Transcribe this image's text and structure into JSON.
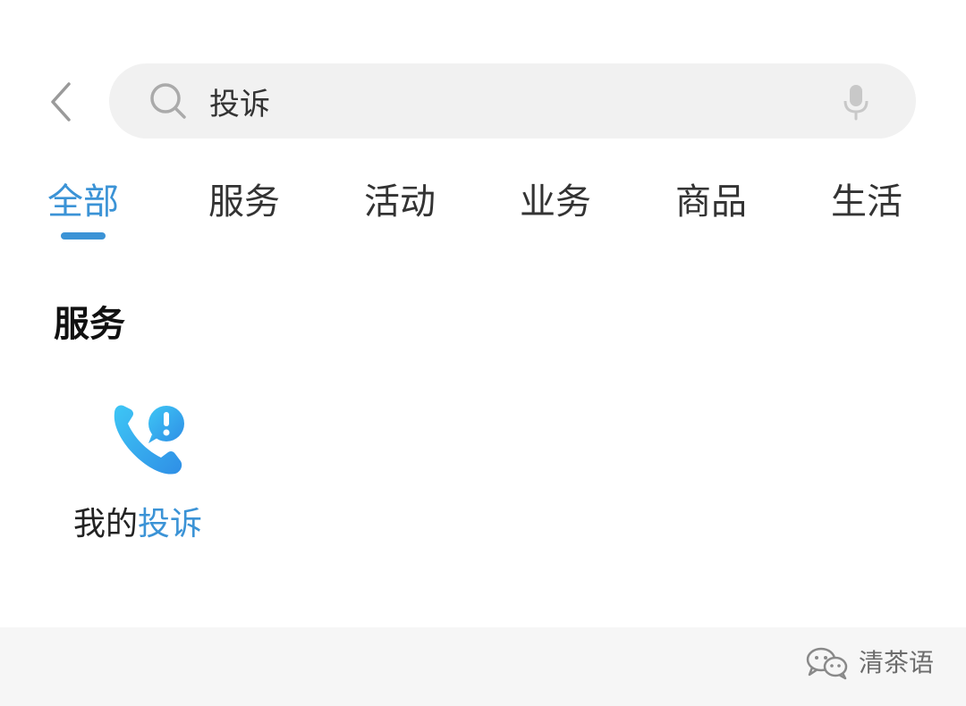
{
  "search": {
    "query": "投诉"
  },
  "tabs": [
    {
      "label": "全部",
      "active": true
    },
    {
      "label": "服务",
      "active": false
    },
    {
      "label": "活动",
      "active": false
    },
    {
      "label": "业务",
      "active": false
    },
    {
      "label": "商品",
      "active": false
    },
    {
      "label": "生活",
      "active": false
    }
  ],
  "section": {
    "title": "服务",
    "items": [
      {
        "label_prefix": "我的",
        "label_highlight": "投诉",
        "icon": "phone-alert-icon"
      }
    ]
  },
  "footer": {
    "watermark": "清茶语"
  },
  "colors": {
    "accent": "#3b93d6",
    "search_bg": "#f1f1f1",
    "footer_bg": "#f6f6f6",
    "icon_gradient_start": "#3ec6f5",
    "icon_gradient_end": "#2f8fe6"
  }
}
